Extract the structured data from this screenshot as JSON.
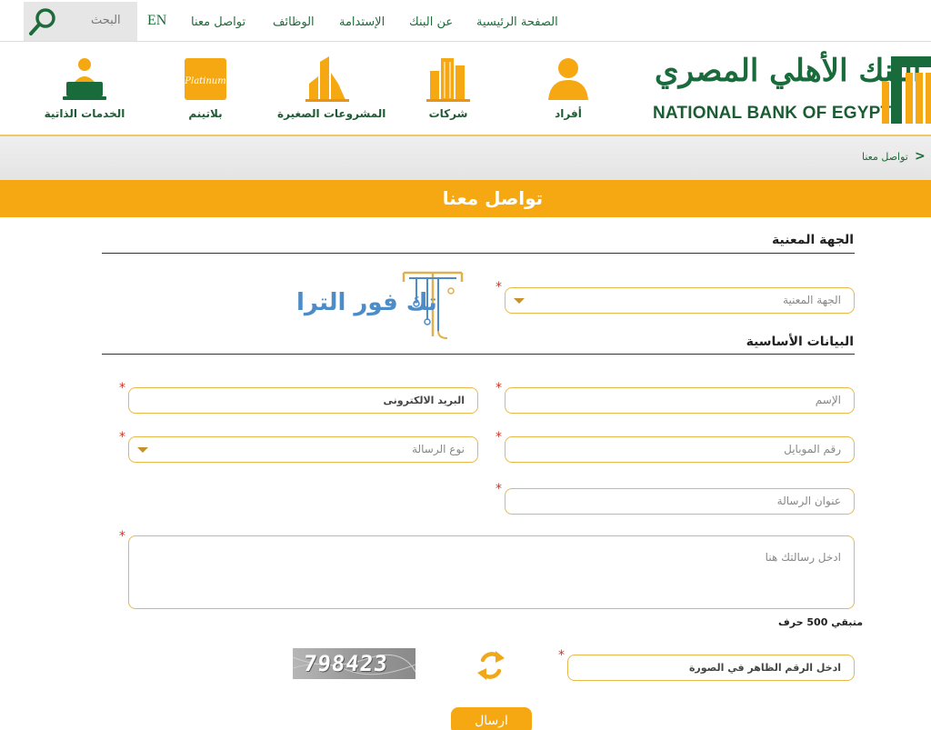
{
  "topnav": {
    "search_label": "البحث",
    "lang": "EN",
    "items": [
      "تواصل معنا",
      "الوظائف",
      "الإستدامة",
      "عن البنك",
      "الصفحة الرئيسية"
    ]
  },
  "header": {
    "categories": [
      "الخدمات الذاتية",
      "بلاتينم",
      "المشروعات الصغيرة",
      "شركات",
      "أفراد"
    ],
    "platinum_script": "Platinum",
    "logo_ar": "البنك الأهلي المصري",
    "logo_en": "NATIONAL BANK OF EGYPT"
  },
  "breadcrumb": {
    "arrow": ">",
    "current": "تواصل معنا"
  },
  "page_title": "تواصل معنا",
  "sections": {
    "department": "الجهة المعنية",
    "basic_info": "البيانات الأساسية"
  },
  "form": {
    "department_select": "الجهة المعنية",
    "name": "الإسم",
    "email": "البريد الالكترونى",
    "mobile": "رقم الموبايل",
    "message_type": "نوع الرسالة",
    "message_subject": "عنوان الرسالة",
    "message_body": "ادخل رسالتك هنا",
    "remaining": "متبقي 500 حرف",
    "captcha_input": "ادخل الرقم الظاهر في الصورة",
    "captcha_code": "798423",
    "submit": "ارسال",
    "required_mark": "*"
  },
  "watermark": {
    "text": "تك فور الترا"
  },
  "colors": {
    "orange": "#f5a811",
    "green": "#1e6b3a",
    "field_border": "#e6b94a"
  }
}
